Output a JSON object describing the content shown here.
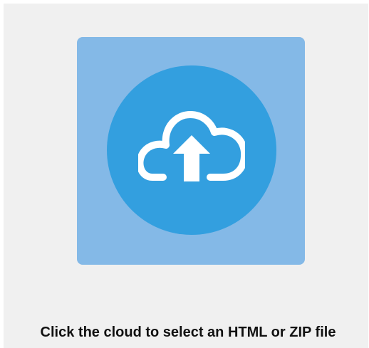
{
  "upload": {
    "icon": "cloud-upload-icon",
    "caption": "Click the cloud to select an HTML or ZIP file"
  },
  "colors": {
    "page_background": "#f0f0f0",
    "tile_background": "#84b9e7",
    "circle_background": "#339fdf",
    "icon_color": "#ffffff",
    "caption_color": "#111111"
  }
}
